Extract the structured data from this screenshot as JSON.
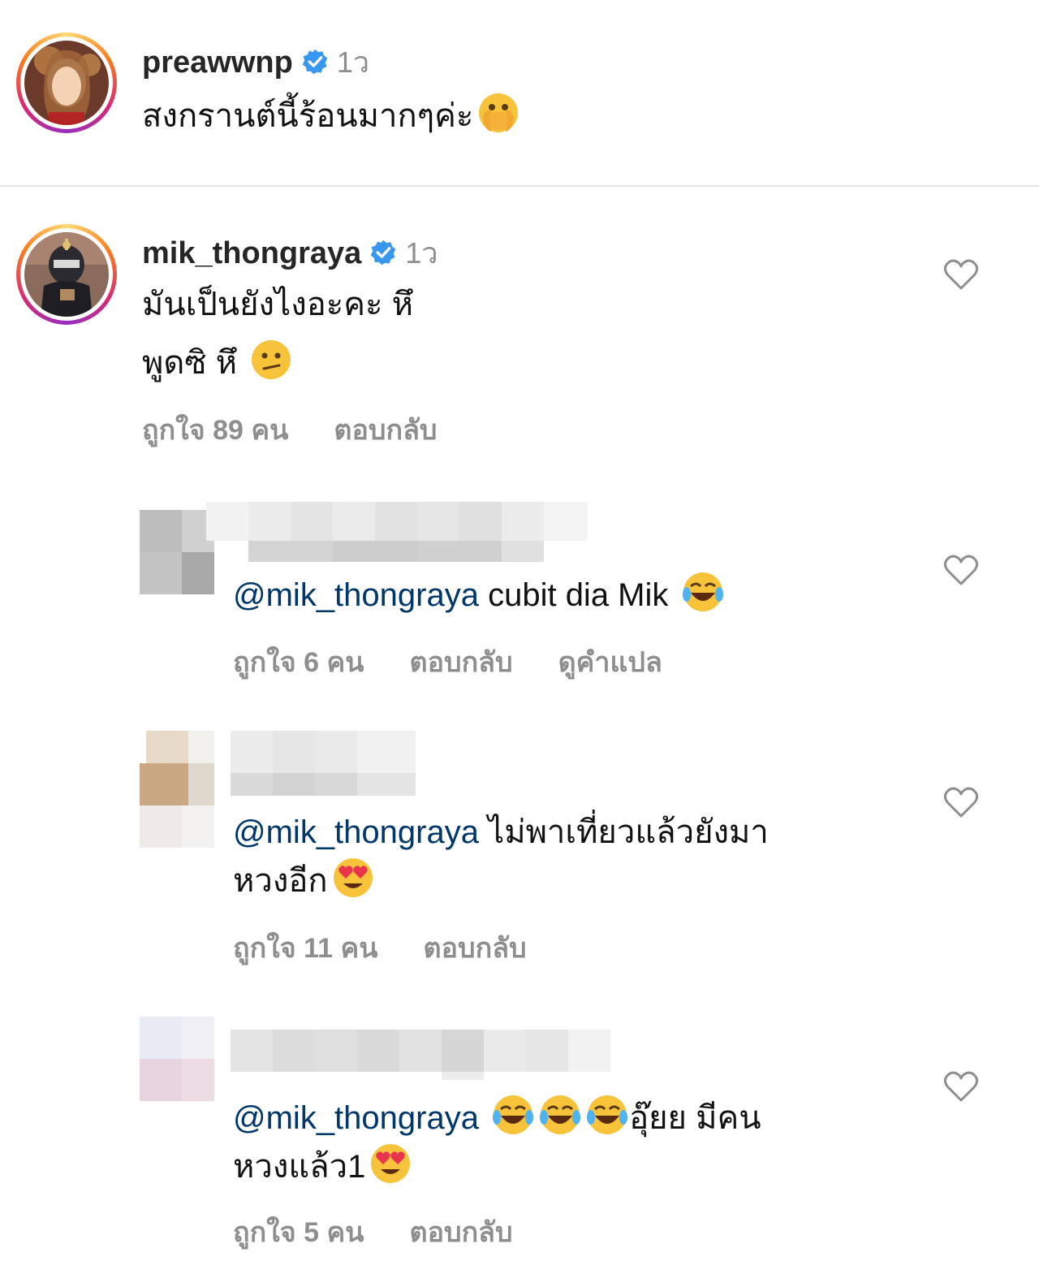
{
  "post": {
    "username": "preawwnp",
    "time": "1ว",
    "caption": "สงกรานต์นี้ร้อนมากๆค่ะ",
    "caption_emoji": "face-with-open-eyes-and-hand-over-mouth"
  },
  "comment_main": {
    "username": "mik_thongraya",
    "time": "1ว",
    "line1": "มันเป็นยังไงอะคะ หึ",
    "line2": "พูดซิ หึ",
    "emoji": "confused-face",
    "likes": "ถูกใจ 89 คน",
    "reply": "ตอบกลับ"
  },
  "replies": [
    {
      "mention": "@mik_thongraya",
      "text": " cubit dia Mik",
      "emoji": "face-with-tears-of-joy",
      "likes": "ถูกใจ 6 คน",
      "reply": "ตอบกลับ",
      "translate": "ดูคำแปล"
    },
    {
      "mention": "@mik_thongraya",
      "text": " ไม่พาเที่ยวแล้วยังมา",
      "text2": "หวงอีก",
      "emoji": "smiling-face-with-heart-eyes",
      "likes": "ถูกใจ 11 คน",
      "reply": "ตอบกลับ"
    },
    {
      "mention": "@mik_thongraya",
      "text": "อุ๊ยย มีคน",
      "text2": "หวงแล้ว1",
      "emoji": "face-with-tears-of-joy",
      "emoji2": "smiling-face-with-heart-eyes",
      "likes": "ถูกใจ 5 คน",
      "reply": "ตอบกลับ"
    }
  ],
  "colors": {
    "verified_blue": "#3897f0",
    "mention_blue": "#00376b",
    "meta_gray": "#8e8e8e"
  }
}
